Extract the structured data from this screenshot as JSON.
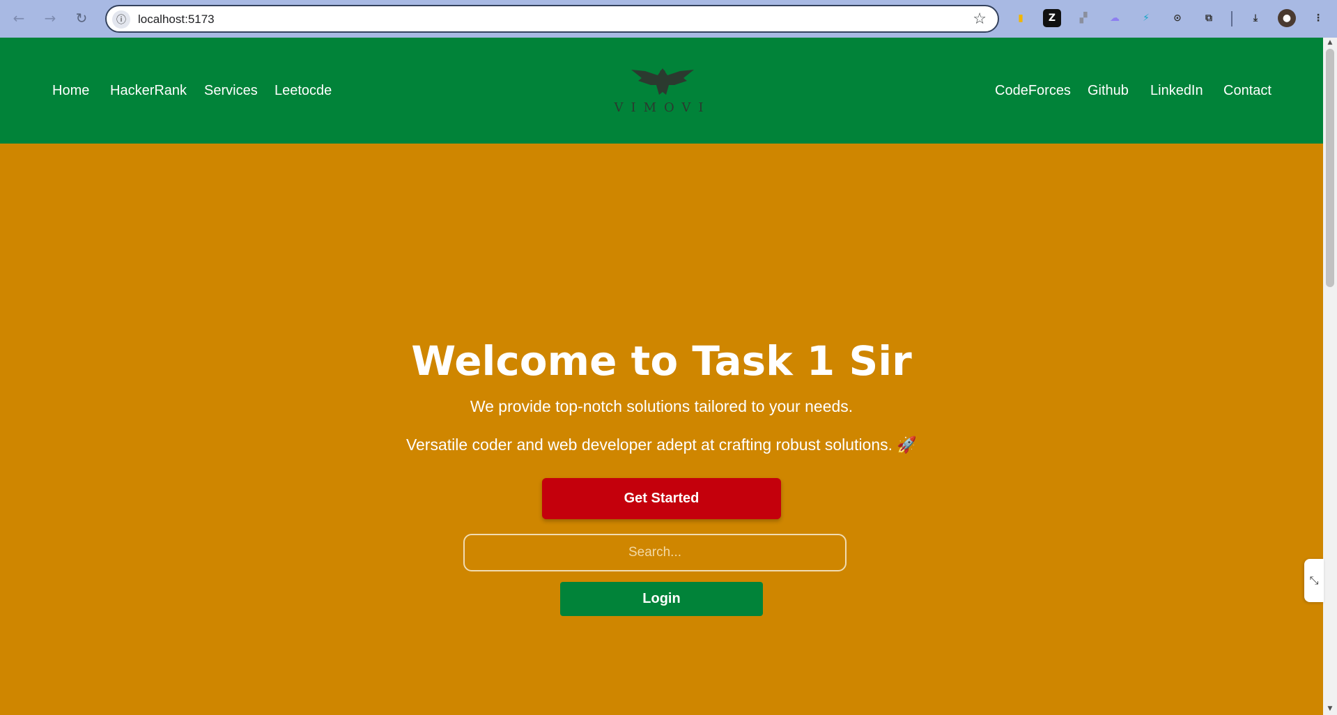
{
  "browser": {
    "url": "localhost:5173",
    "back_icon": "arrow-left-icon",
    "forward_icon": "arrow-right-icon",
    "reload_icon": "reload-icon",
    "extensions": [
      "extension-yellow-icon",
      "zotero-z-icon",
      "extension-gray-icon",
      "extension-purple-icon",
      "extension-blue-icon",
      "code-brackets-icon",
      "puzzle-icon"
    ]
  },
  "header": {
    "left_nav": [
      "Home",
      "HackerRank",
      "Services",
      "Leetocde"
    ],
    "right_nav": [
      "CodeForces",
      "Github",
      "LinkedIn",
      "Contact"
    ],
    "logo_text": "VIMOVI"
  },
  "hero": {
    "title": "Welcome to Task 1 Sir",
    "subtitle": "We provide top-notch solutions tailored to your needs.",
    "tagline": "Versatile coder and web developer adept at crafting robust solutions. 🚀",
    "cta_label": "Get Started",
    "search_placeholder": "Search...",
    "login_label": "Login"
  },
  "colors": {
    "header_bg": "#018339",
    "page_bg": "#cf8600",
    "cta_bg": "#c4000c",
    "login_bg": "#018339"
  }
}
